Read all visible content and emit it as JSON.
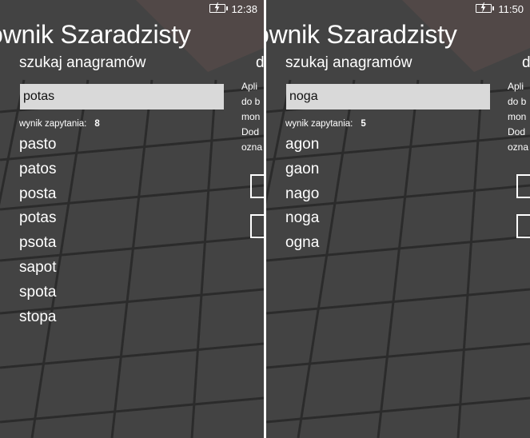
{
  "screens": [
    {
      "status": {
        "time": "12:38",
        "battery_icon": "battery-charging-icon"
      },
      "app_title": "ownik Szaradzisty",
      "page_title": "szukaj anagramów",
      "next_page_peek": "d",
      "search": {
        "value": "potas"
      },
      "result_label": "wynik zapytania:",
      "result_count": "8",
      "results": [
        "pasto",
        "patos",
        "posta",
        "potas",
        "psota",
        "sapot",
        "spota",
        "stopa"
      ],
      "peek_lines": [
        "Apli",
        "do b",
        "mon",
        "Dod",
        "ozna"
      ]
    },
    {
      "status": {
        "time": "11:50",
        "battery_icon": "battery-charging-icon"
      },
      "app_title": "ownik Szaradzisty",
      "page_title": "szukaj anagramów",
      "next_page_peek": "d",
      "search": {
        "value": "noga"
      },
      "result_label": "wynik zapytania:",
      "result_count": "5",
      "results": [
        "agon",
        "gaon",
        "nago",
        "noga",
        "ogna"
      ],
      "peek_lines": [
        "Apli",
        "do b",
        "mon",
        "Dod",
        "ozna"
      ]
    }
  ],
  "colors": {
    "panel_bg": "#4a4a4a",
    "input_bg": "#d9d9d9",
    "text": "#ffffff"
  }
}
